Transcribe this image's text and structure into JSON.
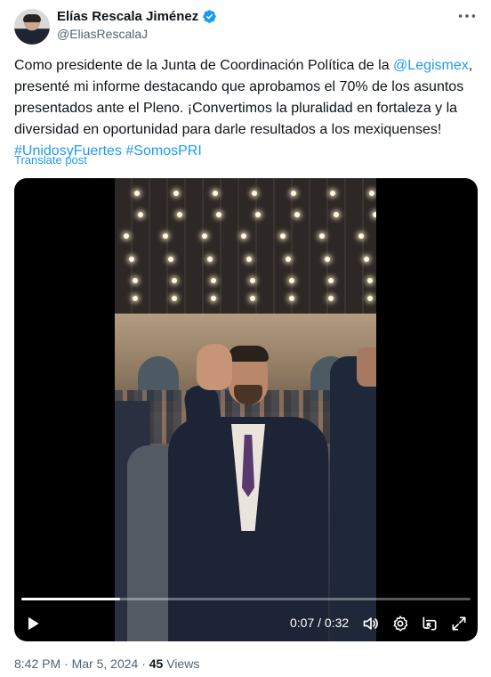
{
  "author": {
    "display_name": "Elías Rescala Jiménez",
    "handle": "@EliasRescalaJ",
    "verified": true
  },
  "tweet": {
    "text_parts": [
      "Como presidente de la Junta de Coordinación Política de la ",
      "@Legismex",
      ", presenté mi informe destacando que aprobamos el 70% de los asuntos presentados ante el Pleno. ¡Convertimos la pluralidad en fortaleza y la diversidad en oportunidad para darle resultados a los mexiquenses!"
    ],
    "hashtags": [
      "#UnidosyFuertes",
      "#SomosPRI"
    ],
    "translate_label": "Translate post"
  },
  "video": {
    "current_time": "0:07",
    "separator": " / ",
    "duration": "0:32",
    "progress_fraction": 0.22
  },
  "footer": {
    "time": "8:42 PM",
    "dot1": " · ",
    "date": "Mar 5, 2024",
    "dot2": " · ",
    "views_count": "45",
    "views_label": " Views"
  },
  "colors": {
    "accent": "#1d9bf0",
    "text": "#0f1419",
    "secondary": "#536471"
  },
  "icons": [
    "verified-badge-icon",
    "more-options-icon",
    "play-icon",
    "volume-icon",
    "settings-icon",
    "pip-icon",
    "fullscreen-icon"
  ]
}
